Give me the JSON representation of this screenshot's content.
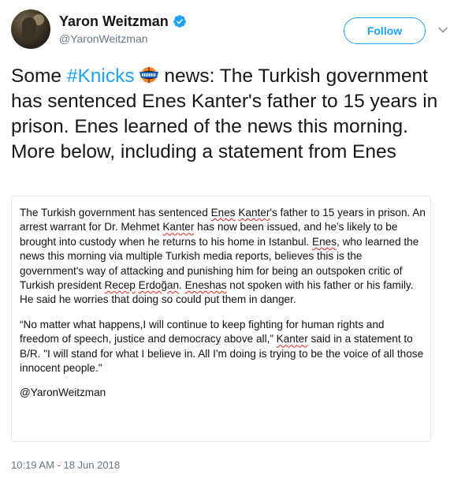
{
  "author": {
    "display_name": "Yaron Weitzman",
    "handle": "@YaronWeitzman"
  },
  "actions": {
    "follow_label": "Follow"
  },
  "tweet": {
    "text_before_hashtag": "Some ",
    "hashtag": "#Knicks",
    "text_after_emoji": " news: The Turkish government has sentenced Enes Kanter's father to 15 years in prison. Enes learned of the news this morning. More below, including a statement from Enes"
  },
  "article": {
    "p1": {
      "a": "The Turkish government has sentenced ",
      "w1": "Enes",
      "b": " ",
      "w2": "Kanter",
      "c": "'s father to 15 years in prison. An arrest warrant for Dr. Mehmet ",
      "w3": "Kanter",
      "d": " has now been issued, and he's likely to be brought into custody when he returns to his home in Istanbul. ",
      "w4": "Enes",
      "e": ", who learned the news this morning via multiple Turkish media reports, believes this is the government's way of attacking and punishing him for being an outspoken critic of Turkish president ",
      "w5": "Recep",
      "f": " ",
      "w6": "Erdoğan",
      "g": ". ",
      "w7": "Eneshas",
      "h": " not spoken with his father or his family. He said he worries that doing so could put them in danger."
    },
    "p2": {
      "a": "“No matter what happens,I will continue to keep fighting for human rights and freedom of speech, justice and democracy above all,” ",
      "w1": "Kanter",
      "b": " said in a statement to B/R. \"I will stand for what I believe in. All I'm doing is trying to be the voice of all those innocent people.\""
    },
    "credit": "@YaronWeitzman"
  },
  "timestamp": "10:19 AM - 18 Jun 2018",
  "colors": {
    "accent": "#1da1f2",
    "text": "#14171a",
    "secondary": "#657786",
    "spell_error": "#e0241b"
  },
  "icons": {
    "verified": "verified-badge-icon",
    "more": "chevron-down-icon",
    "emoji": "knicks-logo-emoji"
  }
}
